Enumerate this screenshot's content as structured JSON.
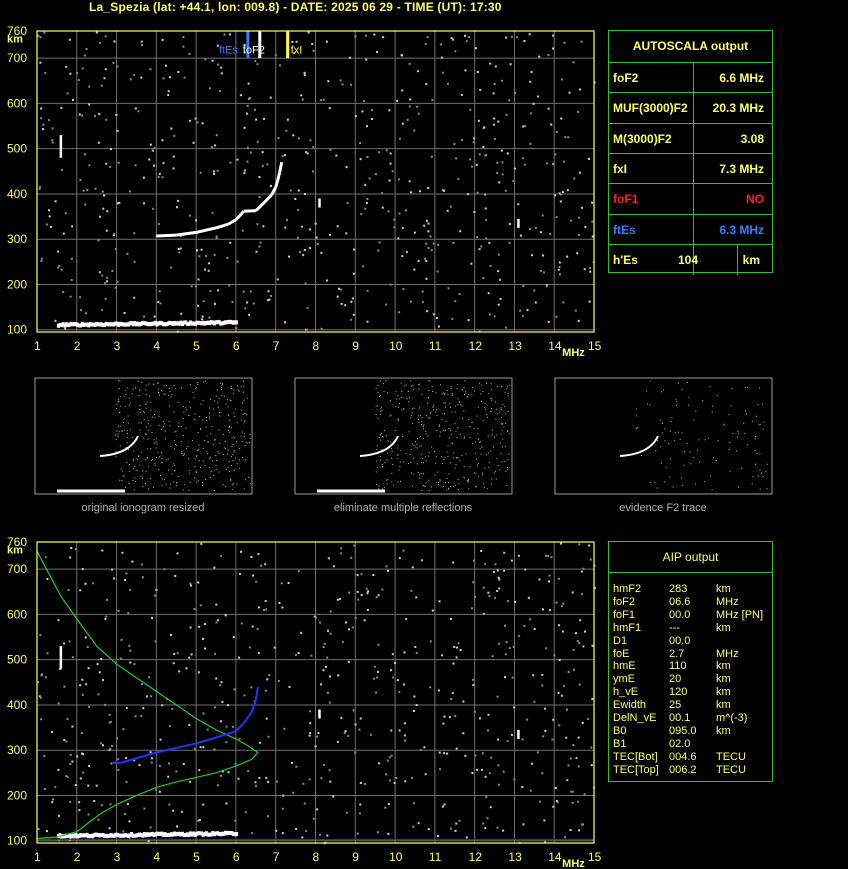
{
  "title": "La_Spezia (lat: +44.1, lon: 009.8) - DATE: 2025 06 29 - TIME (UT): 17:30",
  "chart_data": [
    {
      "type": "scatter",
      "name": "ionogram-top",
      "xlabel": "MHz",
      "ylabel": "km",
      "xlim": [
        1,
        15
      ],
      "ylim": [
        95,
        760
      ],
      "xticks": [
        1,
        2,
        3,
        4,
        5,
        6,
        7,
        8,
        9,
        10,
        11,
        12,
        13,
        14,
        15
      ],
      "yticks": [
        100,
        200,
        300,
        400,
        500,
        600,
        700,
        760
      ],
      "grid": true,
      "f_layer_trace": [
        [
          4.0,
          307
        ],
        [
          4.5,
          309
        ],
        [
          5.0,
          315
        ],
        [
          5.5,
          325
        ],
        [
          5.8,
          333
        ],
        [
          6.0,
          343
        ],
        [
          6.1,
          352
        ],
        [
          6.2,
          362
        ],
        [
          6.5,
          363
        ],
        [
          6.7,
          380
        ],
        [
          6.9,
          398
        ],
        [
          7.0,
          415
        ],
        [
          7.05,
          430
        ],
        [
          7.1,
          448
        ],
        [
          7.15,
          470
        ]
      ],
      "e_layer_trace": [
        [
          1.5,
          115
        ],
        [
          2.0,
          115
        ],
        [
          2.5,
          116
        ],
        [
          3.0,
          117
        ],
        [
          3.5,
          118
        ],
        [
          4.0,
          118
        ],
        [
          4.5,
          119
        ],
        [
          5.0,
          120
        ],
        [
          5.5,
          120
        ],
        [
          6.0,
          120
        ]
      ],
      "markers": [
        {
          "label": "ftEs",
          "freq": 6.3,
          "color": "#3a7bff"
        },
        {
          "label": "foF2",
          "freq": 6.6,
          "color": "#ffffff"
        },
        {
          "label": "fxI",
          "freq": 7.3,
          "color": "#ffff33"
        }
      ]
    },
    {
      "type": "scatter",
      "name": "ionogram-bottom",
      "xlabel": "MHz",
      "ylabel": "km",
      "xlim": [
        1,
        15
      ],
      "ylim": [
        95,
        760
      ],
      "xticks": [
        1,
        2,
        3,
        4,
        5,
        6,
        7,
        8,
        9,
        10,
        11,
        12,
        13,
        14,
        15
      ],
      "yticks": [
        100,
        200,
        300,
        400,
        500,
        600,
        700,
        760
      ],
      "grid": true,
      "profile_curve": [
        [
          1.0,
          740
        ],
        [
          1.3,
          690
        ],
        [
          1.6,
          640
        ],
        [
          2.0,
          590
        ],
        [
          2.5,
          530
        ],
        [
          3.0,
          490
        ],
        [
          3.5,
          460
        ],
        [
          4.0,
          430
        ],
        [
          4.5,
          400
        ],
        [
          5.0,
          370
        ],
        [
          5.5,
          345
        ],
        [
          6.0,
          325
        ],
        [
          6.3,
          310
        ],
        [
          6.55,
          295
        ],
        [
          6.4,
          280
        ],
        [
          6.0,
          265
        ],
        [
          5.5,
          250
        ],
        [
          5.0,
          240
        ],
        [
          4.5,
          230
        ],
        [
          4.0,
          218
        ],
        [
          3.5,
          200
        ],
        [
          3.0,
          180
        ],
        [
          2.6,
          160
        ],
        [
          2.3,
          140
        ],
        [
          2.0,
          120
        ],
        [
          1.5,
          108
        ],
        [
          1.0,
          105
        ]
      ],
      "blue_trace": [
        [
          2.9,
          272
        ],
        [
          3.1,
          272
        ],
        [
          3.5,
          282
        ],
        [
          4.0,
          295
        ],
        [
          4.5,
          305
        ],
        [
          5.0,
          315
        ],
        [
          5.5,
          328
        ],
        [
          6.0,
          342
        ],
        [
          6.2,
          360
        ],
        [
          6.4,
          385
        ],
        [
          6.5,
          410
        ],
        [
          6.55,
          440
        ]
      ],
      "e_layer_trace": [
        [
          1.5,
          115
        ],
        [
          2.0,
          115
        ],
        [
          2.5,
          116
        ],
        [
          3.0,
          117
        ],
        [
          3.5,
          118
        ],
        [
          4.0,
          118
        ],
        [
          4.5,
          119
        ],
        [
          5.0,
          120
        ],
        [
          5.5,
          120
        ],
        [
          6.0,
          120
        ]
      ]
    }
  ],
  "thumbnails": [
    {
      "caption": "original ionogram resized"
    },
    {
      "caption": "eliminate multiple reflections"
    },
    {
      "caption": "evidence F2 trace"
    }
  ],
  "autoscala": {
    "title": "AUTOSCALA output",
    "rows": [
      {
        "k": "foF2",
        "v": "6.6 MHz",
        "color": "#ffff66"
      },
      {
        "k": "MUF(3000)F2",
        "v": "20.3 MHz",
        "color": "#ffff66"
      },
      {
        "k": "M(3000)F2",
        "v": "3.08",
        "color": "#ffff66"
      },
      {
        "k": "fxI",
        "v": "7.3 MHz",
        "color": "#ffff66"
      },
      {
        "k": "foF1",
        "v": "NO",
        "color": "#ff2020"
      },
      {
        "k": "ftEs",
        "v": "6.3 MHz",
        "color": "#3a7bff"
      },
      {
        "k": "h'Es",
        "v": "104",
        "unit": "km",
        "color": "#ffff66"
      }
    ]
  },
  "aip": {
    "title": "AIP output",
    "rows": [
      {
        "name": "hmF2",
        "val": "283",
        "unit": "km"
      },
      {
        "name": "foF2",
        "val": "06.6",
        "unit": "MHz"
      },
      {
        "name": "foF1",
        "val": "00.0",
        "unit": "MHz   [PN]"
      },
      {
        "name": "hmF1",
        "val": "---",
        "unit": "km"
      },
      {
        "name": "D1",
        "val": "00.0",
        "unit": ""
      },
      {
        "name": "foE",
        "val": "2.7",
        "unit": "MHz"
      },
      {
        "name": "hmE",
        "val": "110",
        "unit": "km"
      },
      {
        "name": "ymE",
        "val": "20",
        "unit": "km"
      },
      {
        "name": "h_vE",
        "val": "120",
        "unit": "km"
      },
      {
        "name": "Ewidth",
        "val": "25",
        "unit": "km"
      },
      {
        "name": "DelN_vE",
        "val": "00.1",
        "unit": "m^(-3)"
      },
      {
        "name": "B0",
        "val": "095.0",
        "unit": "km"
      },
      {
        "name": "B1",
        "val": "02.0",
        "unit": ""
      },
      {
        "name": "TEC[Bot]",
        "val": "004.6",
        "unit": "TECU"
      },
      {
        "name": "TEC[Top]",
        "val": "006.2",
        "unit": "TECU"
      }
    ]
  }
}
